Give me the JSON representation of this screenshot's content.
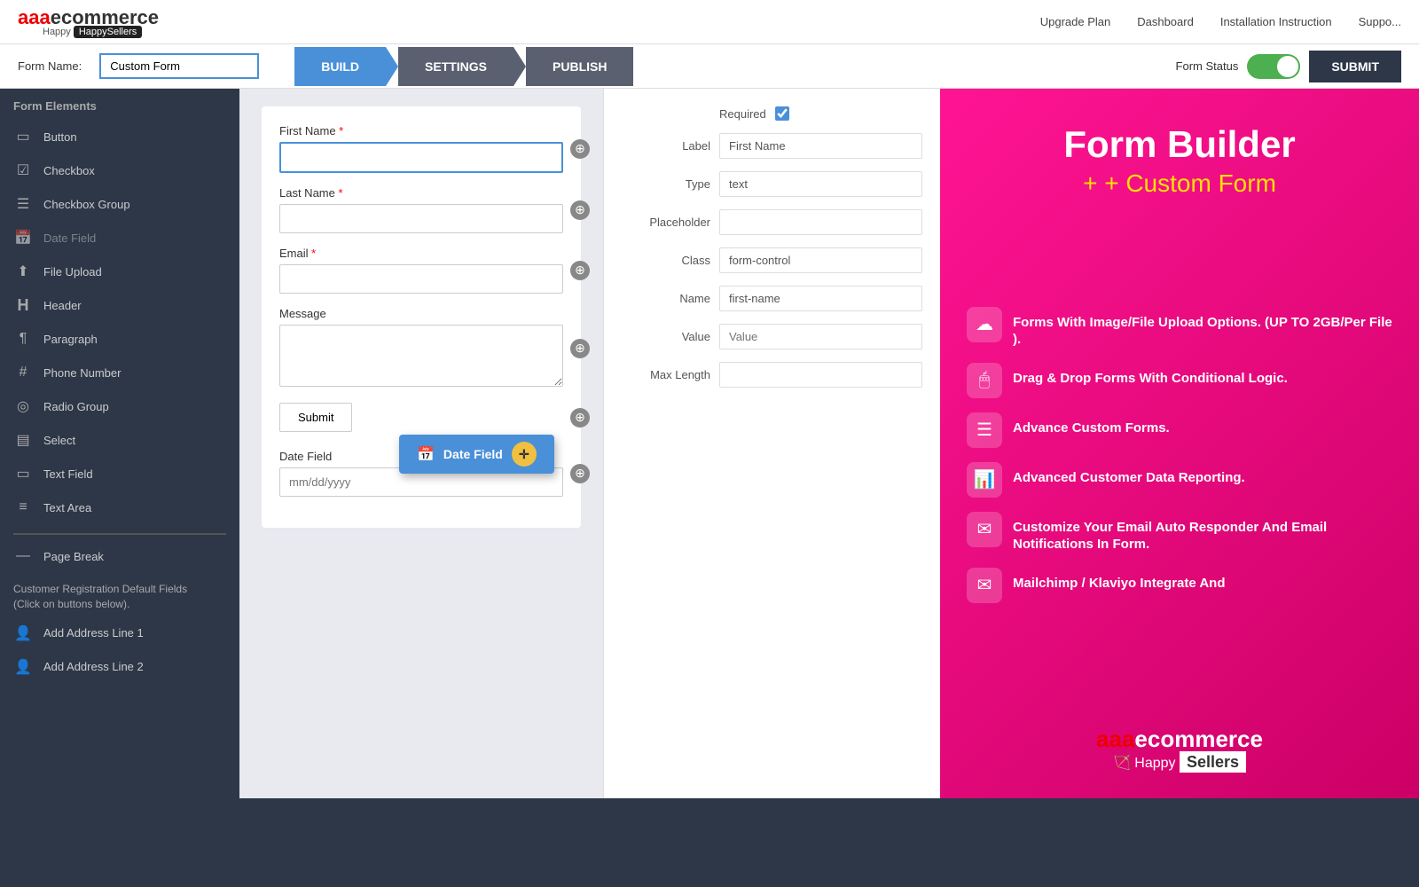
{
  "topnav": {
    "logo": "aaa",
    "logo_suffix": "ecommerce",
    "logo_sub": "HappySellers",
    "links": [
      "Upgrade Plan",
      "Dashboard",
      "Installation Instruction",
      "Suppo..."
    ]
  },
  "formbar": {
    "form_name_label": "Form Name:",
    "form_name_value": "Custom Form",
    "tabs": [
      {
        "label": "BUILD",
        "active": true
      },
      {
        "label": "SETTINGS",
        "active": false
      },
      {
        "label": "PUBLISH",
        "active": false
      }
    ],
    "form_status_label": "Form Status",
    "submit_label": "SUBMIT"
  },
  "sidebar": {
    "section_title": "Form Elements",
    "items": [
      {
        "icon": "▭",
        "label": "Button"
      },
      {
        "icon": "☑",
        "label": "Checkbox"
      },
      {
        "icon": "☰",
        "label": "Checkbox Group"
      },
      {
        "icon": "📅",
        "label": "Date Field",
        "muted": true
      },
      {
        "icon": "⬆",
        "label": "File Upload"
      },
      {
        "icon": "H",
        "label": "Header"
      },
      {
        "icon": "¶",
        "label": "Paragraph"
      },
      {
        "icon": "#",
        "label": "Phone Number"
      },
      {
        "icon": "☰",
        "label": "Radio Group"
      },
      {
        "icon": "▤",
        "label": "Select"
      },
      {
        "icon": "▭",
        "label": "Text Field"
      },
      {
        "icon": "≡",
        "label": "Text Area"
      },
      {
        "icon": "—",
        "label": "Page Break"
      }
    ],
    "customer_section_title": "Customer Registration Default Fields",
    "customer_section_sub": "(Click on buttons below).",
    "customer_items": [
      {
        "icon": "👤",
        "label": "Add Address Line 1"
      },
      {
        "icon": "👤",
        "label": "Add Address Line 2"
      }
    ]
  },
  "form_canvas": {
    "fields": [
      {
        "label": "First Name",
        "required": true,
        "type": "text",
        "active": true
      },
      {
        "label": "Last Name",
        "required": true,
        "type": "text"
      },
      {
        "label": "Email",
        "required": true,
        "type": "text"
      },
      {
        "label": "Message",
        "required": false,
        "type": "textarea"
      },
      {
        "label": "Submit",
        "type": "submit"
      },
      {
        "label": "Date Field",
        "required": false,
        "type": "date",
        "placeholder": "mm/dd/yyyy"
      }
    ],
    "drag_item": {
      "label": "Date Field",
      "icon": "📅"
    }
  },
  "right_panel": {
    "required_label": "Required",
    "fields": [
      {
        "label": "Label",
        "value": "First Name"
      },
      {
        "label": "Type",
        "value": "text"
      },
      {
        "label": "Placeholder",
        "value": ""
      },
      {
        "label": "Class",
        "value": "form-control"
      },
      {
        "label": "Name",
        "value": "first-name"
      },
      {
        "label": "Value",
        "placeholder": "Value"
      },
      {
        "label": "Max Length",
        "value": ""
      }
    ]
  },
  "promo": {
    "title": "Form Builder",
    "subtitle": "+ Custom Form",
    "features": [
      {
        "text": "Forms With Image/File Upload Options. (UP TO 2GB/Per File )."
      },
      {
        "text": "Drag & Drop Forms With Conditional Logic."
      },
      {
        "text": "Advance Custom Forms."
      },
      {
        "text": "Advanced Customer Data Reporting."
      },
      {
        "text": "Customize Your Email Auto Responder And Email Notifications In Form."
      },
      {
        "text": "Mailchimp / Klaviyo Integrate And"
      }
    ],
    "logo": "aaaecommerce",
    "logo_sub": "Happy",
    "logo_tag": "Sellers"
  }
}
